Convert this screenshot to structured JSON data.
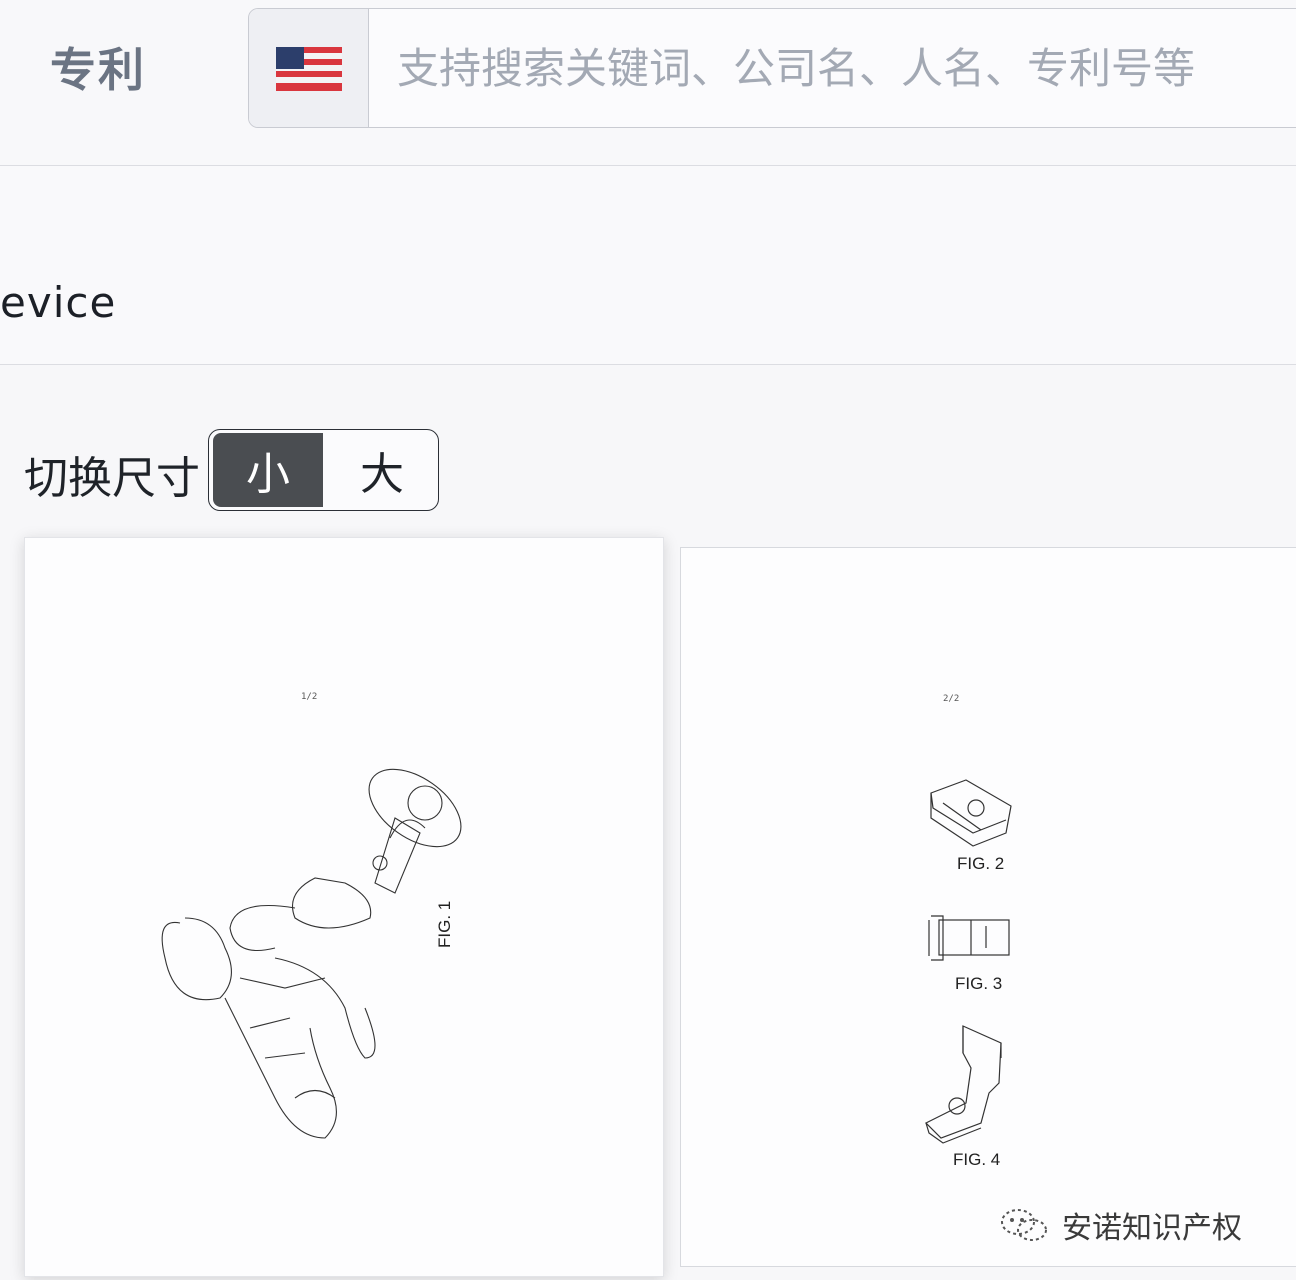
{
  "header": {
    "brand": "专利",
    "search": {
      "placeholder": "支持搜索关键词、公司名、人名、专利号等",
      "value": ""
    }
  },
  "patent": {
    "title_fragment": "evice"
  },
  "size_toggle": {
    "label": "切换尺寸",
    "options": [
      "小",
      "大"
    ],
    "selected": "小"
  },
  "drawings": [
    {
      "sheet": "1/2",
      "figures": [
        "FIG. 1"
      ]
    },
    {
      "sheet": "2/2",
      "figures": [
        "FIG. 2",
        "FIG. 3",
        "FIG. 4"
      ]
    }
  ],
  "watermark": "安诺知识产权",
  "icons": [
    "us-flag-icon",
    "wechat-watermark-icon"
  ],
  "colors": {
    "brand": "#6b7483",
    "toggle_active_bg": "#4a4d51",
    "placeholder": "#a3a9b4"
  }
}
